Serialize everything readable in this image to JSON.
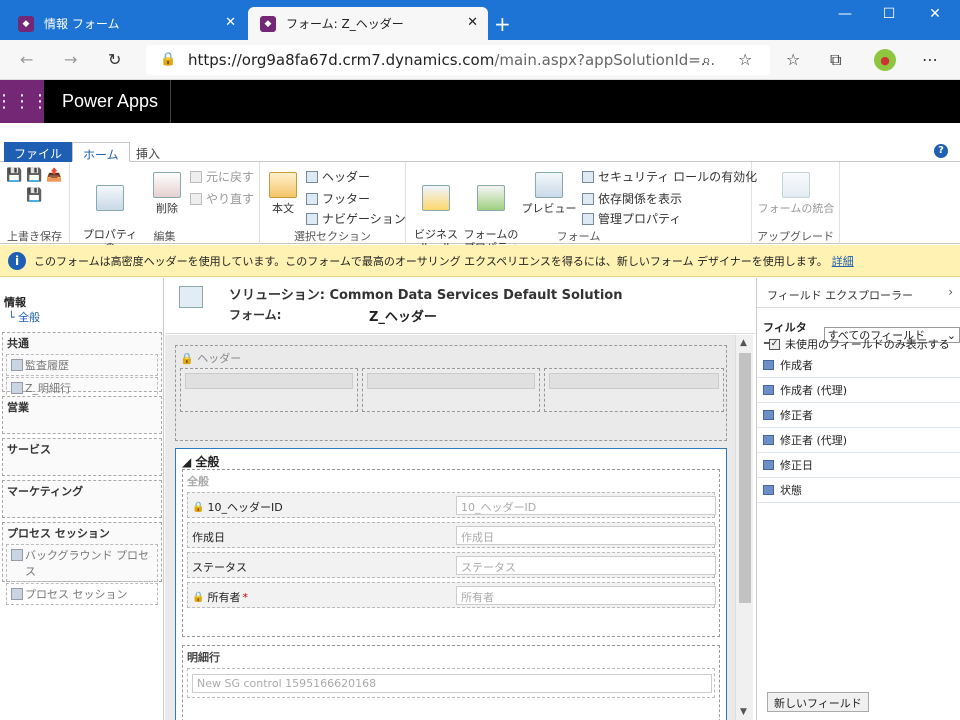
{
  "browser": {
    "tabs": [
      {
        "label": "情報 フォーム",
        "active": false
      },
      {
        "label": "フォーム: Z_ヘッダー",
        "active": true
      }
    ],
    "url_host": "https://org9a8fa67d.crm7.dynamics.com",
    "url_path": "/main.aspx?appSolutionId=..."
  },
  "app": {
    "brand": "Power Apps"
  },
  "ribbon": {
    "tabs": {
      "file": "ファイル",
      "home": "ホーム",
      "insert": "挿入"
    },
    "groups": {
      "save": "上書き保存",
      "edit": "編集",
      "select": "選択セクション",
      "form": "フォーム",
      "upgrade": "アップグレード"
    },
    "buttons": {
      "properties": "プロパティの\n変更",
      "delete": "削除",
      "undo": "元に戻す",
      "redo": "やり直す",
      "body": "本文",
      "header": "ヘッダー",
      "footer": "フッター",
      "navigation": "ナビゲーション",
      "business_rules": "ビジネス\nルール",
      "form_properties": "フォームの\nプロパティ",
      "preview": "プレビュー",
      "security_roles": "セキュリティ ロールの有効化",
      "dependencies": "依存関係を表示",
      "managed_properties": "管理プロパティ",
      "merge_forms": "フォームの統合"
    }
  },
  "infobar": {
    "text": "このフォームは高密度ヘッダーを使用しています。このフォームで最高のオーサリング エクスペリエンスを得るには、新しいフォーム デザイナーを使用します。",
    "link": "詳細"
  },
  "leftnav": {
    "info_heading": "情報",
    "info_sub": "└ 全般",
    "sections": [
      {
        "title": "共通",
        "items": [
          "監査履歴",
          "Z_明細行"
        ]
      },
      {
        "title": "営業",
        "items": []
      },
      {
        "title": "サービス",
        "items": []
      },
      {
        "title": "マーケティング",
        "items": []
      },
      {
        "title": "プロセス セッション",
        "items": [
          "バックグラウンド プロセス",
          "プロセス セッション"
        ]
      }
    ]
  },
  "form": {
    "solution": "ソリューション: Common Data Services Default Solution",
    "form_label": "フォーム:",
    "form_name": "Z_ヘッダー",
    "header_label": "ヘッダー",
    "tab_title": "全般",
    "section_label": "全般",
    "fields": [
      {
        "label": "10_ヘッダーID",
        "placeholder": "10_ヘッダーID",
        "locked": true,
        "required": false
      },
      {
        "label": "作成日",
        "placeholder": "作成日",
        "locked": false,
        "required": false
      },
      {
        "label": "ステータス",
        "placeholder": "ステータス",
        "locked": false,
        "required": false
      },
      {
        "label": "所有者",
        "placeholder": "所有者",
        "locked": true,
        "required": true
      }
    ],
    "detail_section_label": "明細行",
    "subgrid_placeholder": "New SG control 1595166620168"
  },
  "explorer": {
    "title": "フィールド エクスプローラー",
    "filter_label": "フィルター",
    "filter_value": "すべてのフィールド",
    "unused_only_label": "未使用のフィールドのみ表示する",
    "unused_only_checked": true,
    "fields": [
      "作成者",
      "作成者 (代理)",
      "修正者",
      "修正者 (代理)",
      "修正日",
      "状態"
    ],
    "new_field_button": "新しいフィールド"
  }
}
